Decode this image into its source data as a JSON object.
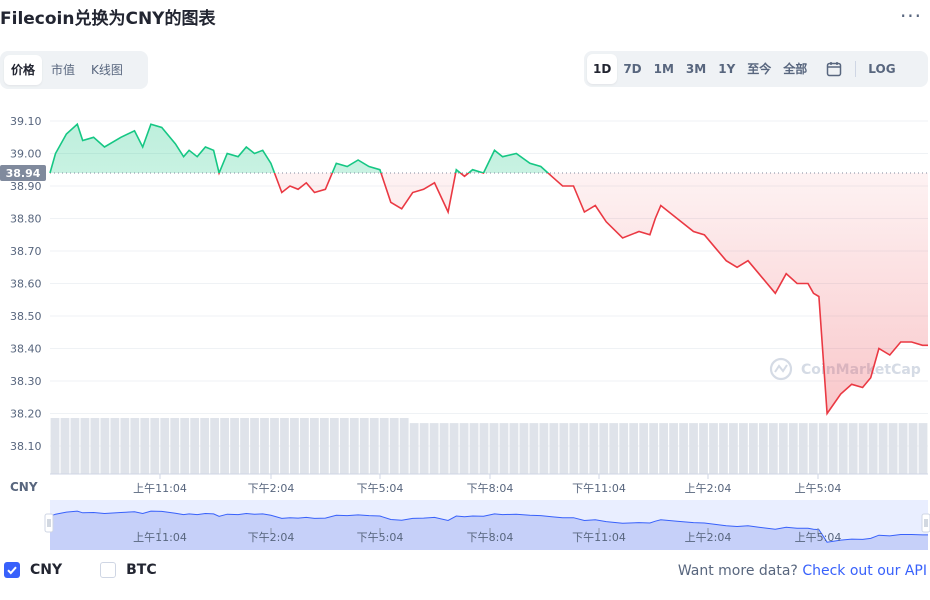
{
  "header": {
    "title": "Filecoin兑换为CNY的图表",
    "more_label": "···"
  },
  "view_tabs": [
    {
      "label": "价格",
      "active": true
    },
    {
      "label": "市值",
      "active": false
    },
    {
      "label": "K线图",
      "active": false
    }
  ],
  "range_tabs": [
    {
      "label": "1D",
      "active": true
    },
    {
      "label": "7D",
      "active": false
    },
    {
      "label": "1M",
      "active": false
    },
    {
      "label": "3M",
      "active": false
    },
    {
      "label": "1Y",
      "active": false
    },
    {
      "label": "至今",
      "active": false
    },
    {
      "label": "全部",
      "active": false
    }
  ],
  "log_label": "LOG",
  "currency_label": "CNY",
  "watermark": "CoinMarketCap",
  "chart_data": {
    "type": "line",
    "title": "Filecoin兑换为CNY的图表",
    "xlabel": "",
    "ylabel": "",
    "ylim": [
      38.05,
      39.15
    ],
    "grid": true,
    "yticks": [
      39.1,
      39.0,
      38.9,
      38.8,
      38.7,
      38.6,
      38.5,
      38.4,
      38.3,
      38.2,
      38.1
    ],
    "ytick_labels": [
      "39.10",
      "39.00",
      "38.90",
      "38.80",
      "38.70",
      "38.60",
      "38.50",
      "38.40",
      "38.30",
      "38.20",
      "38.10"
    ],
    "xtick_labels": [
      "上午11:04",
      "下午2:04",
      "下午5:04",
      "下午8:04",
      "下午11:04",
      "上午2:04",
      "上午5:04"
    ],
    "reference_value": 38.94,
    "reference_label": "38.94",
    "above_color": "#16c784",
    "below_color": "#ea3943",
    "series": [
      {
        "name": "CNY",
        "x": [
          0,
          0.1,
          0.3,
          0.5,
          0.6,
          0.8,
          1,
          1.3,
          1.55,
          1.7,
          1.85,
          2.05,
          2.3,
          2.45,
          2.55,
          2.7,
          2.85,
          3.0,
          3.1,
          3.25,
          3.45,
          3.6,
          3.75,
          3.9,
          4.05,
          4.25,
          4.4,
          4.55,
          4.7,
          4.85,
          5.05,
          5.25,
          5.45,
          5.65,
          5.85,
          6.05,
          6.25,
          6.45,
          6.65,
          6.85,
          7.05,
          7.3,
          7.45,
          7.6,
          7.75,
          7.95,
          8.15,
          8.3,
          8.55,
          8.8,
          9.0,
          9.2,
          9.4,
          9.6,
          9.8,
          10.0,
          10.2,
          10.5,
          10.8,
          11.0,
          11.1,
          11.2,
          11.5,
          11.8,
          12.0,
          12.2,
          12.4,
          12.6,
          12.8,
          13.0,
          13.3,
          13.5,
          13.7,
          13.9,
          14.0,
          14.1,
          14.25,
          14.5,
          14.7,
          14.9,
          15.05,
          15.2,
          15.4,
          15.6,
          15.8,
          16.0,
          16.05,
          16.1
        ],
        "values": [
          38.94,
          39.0,
          39.06,
          39.09,
          39.04,
          39.05,
          39.02,
          39.05,
          39.07,
          39.02,
          39.09,
          39.08,
          39.03,
          38.99,
          39.01,
          38.99,
          39.02,
          39.01,
          38.94,
          39.0,
          38.99,
          39.02,
          39.0,
          39.01,
          38.97,
          38.88,
          38.9,
          38.89,
          38.91,
          38.88,
          38.89,
          38.97,
          38.96,
          38.98,
          38.96,
          38.95,
          38.85,
          38.83,
          38.88,
          38.89,
          38.91,
          38.82,
          38.95,
          38.93,
          38.95,
          38.94,
          39.01,
          38.99,
          39.0,
          38.97,
          38.96,
          38.93,
          38.9,
          38.9,
          38.82,
          38.84,
          38.79,
          38.74,
          38.76,
          38.75,
          38.8,
          38.84,
          38.8,
          38.76,
          38.75,
          38.71,
          38.67,
          38.65,
          38.67,
          38.63,
          38.57,
          38.63,
          38.6,
          38.6,
          38.57,
          38.56,
          38.2,
          38.26,
          38.29,
          38.28,
          38.31,
          38.4,
          38.38,
          38.42,
          38.42,
          38.41,
          38.41,
          38.41
        ]
      }
    ],
    "volume": [
      11,
      11,
      11,
      11,
      11,
      11,
      11,
      11,
      11,
      11,
      11,
      11,
      11,
      11,
      11,
      11,
      11,
      11,
      11,
      11,
      11,
      11,
      11,
      11,
      11,
      11,
      11,
      11,
      11,
      11,
      11,
      11,
      11,
      11,
      11,
      11,
      10,
      10,
      10,
      10,
      10,
      10,
      10,
      10,
      10,
      10,
      10,
      10,
      10,
      10,
      10,
      10,
      10,
      10,
      10,
      10,
      10,
      10,
      10,
      10,
      10,
      10,
      10,
      10,
      10,
      10,
      10,
      10,
      10,
      10,
      10,
      10,
      10,
      10,
      10,
      10,
      10,
      10,
      10,
      10,
      10,
      10,
      10,
      10,
      10,
      10,
      10,
      10
    ],
    "navigator": {
      "xtick_labels": [
        "上午11:04",
        "下午2:04",
        "下午5:04",
        "下午8:04",
        "下午11:04",
        "上午2:04",
        "上午5:04"
      ]
    }
  },
  "legend": [
    {
      "label": "CNY",
      "checked": true
    },
    {
      "label": "BTC",
      "checked": false
    }
  ],
  "api_promo": {
    "text": "Want more data?",
    "link": "Check out our API"
  }
}
